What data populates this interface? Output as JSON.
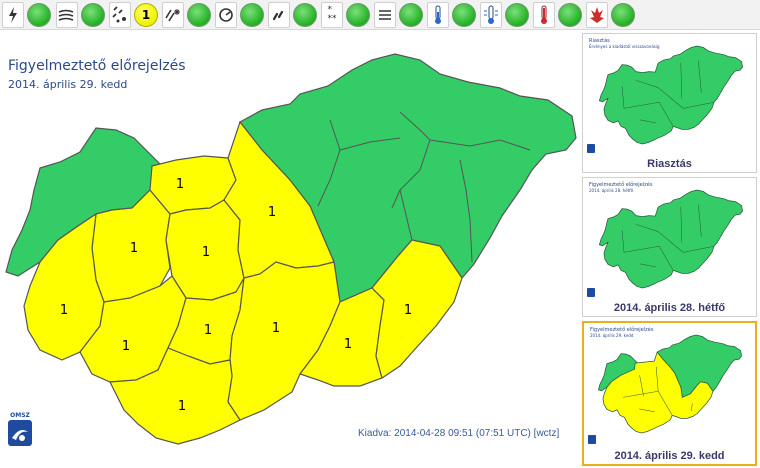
{
  "toolbar": {
    "items": [
      {
        "icon": "lightning-icon",
        "status": "green",
        "label": ""
      },
      {
        "icon": "wind-icon",
        "status": "green",
        "label": ""
      },
      {
        "icon": "rain-snow-icon",
        "status": "yellow",
        "label": "1"
      },
      {
        "icon": "freezing-rain-icon",
        "status": "green",
        "label": ""
      },
      {
        "icon": "hail-icon",
        "status": "green",
        "label": ""
      },
      {
        "icon": "rain-icon",
        "status": "green",
        "label": ""
      },
      {
        "icon": "snow-icon",
        "status": "green",
        "label": ""
      },
      {
        "icon": "fog-icon",
        "status": "green",
        "label": ""
      },
      {
        "icon": "cold-thermometer-icon",
        "status": "green",
        "label": ""
      },
      {
        "icon": "frost-icon",
        "status": "green",
        "label": ""
      },
      {
        "icon": "heat-thermometer-icon",
        "status": "green",
        "label": ""
      },
      {
        "icon": "fire-icon",
        "status": "green",
        "label": ""
      }
    ]
  },
  "main": {
    "title": "Figyelmeztető előrejelzés",
    "date": "2014. április 29. kedd",
    "issued": "Kiadva: 2014-04-28 09:51 (07:51 UTC) [wctz]",
    "logo_text": "OMSZ",
    "region_label": "1"
  },
  "thumbnails": [
    {
      "caption": "Riasztás",
      "small_title": "Riasztás",
      "small_sub": "Érvényes a kiadástól visszavonásig",
      "selected": false
    },
    {
      "caption": "2014. április 28. hétfő",
      "small_title": "Figyelmeztető előrejelzés",
      "small_sub": "2014. április 28. hétfő",
      "selected": false
    },
    {
      "caption": "2014. április 29. kedd",
      "small_title": "Figyelmeztető előrejelzés",
      "small_sub": "2014. április 29. kedd",
      "selected": true
    }
  ],
  "colors": {
    "green": "#33cc66",
    "yellow": "#ffff00",
    "border": "#555555",
    "title": "#2a4a8a",
    "selected": "#e8b020"
  }
}
